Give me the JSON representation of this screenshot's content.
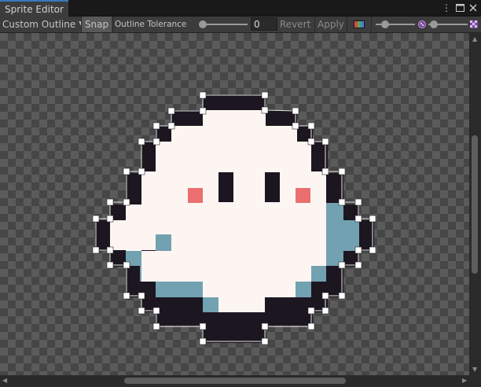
{
  "window": {
    "tab_title": "Sprite Editor",
    "menu_icon": "kebab-menu-icon",
    "maximize_icon": "maximize-icon",
    "close_icon": "close-icon"
  },
  "toolbar": {
    "mode_dropdown": "Custom Outline",
    "snap_label": "Snap",
    "snap_active": true,
    "tolerance_label": "Outline Tolerance",
    "tolerance_value": "0",
    "revert_label": "Revert",
    "apply_label": "Apply",
    "channel_icon": "rgb-channels-icon",
    "zoom_icon": "zoom-icon",
    "mip_icon": "mip-level-icon",
    "tolerance_slider_value": 0
  },
  "colors": {
    "outline_dark": "#1c1620",
    "body": "#fdf5f1",
    "shadow": "#72a1b1",
    "cheek": "#eb6f70",
    "accent": "#3a79bb"
  }
}
